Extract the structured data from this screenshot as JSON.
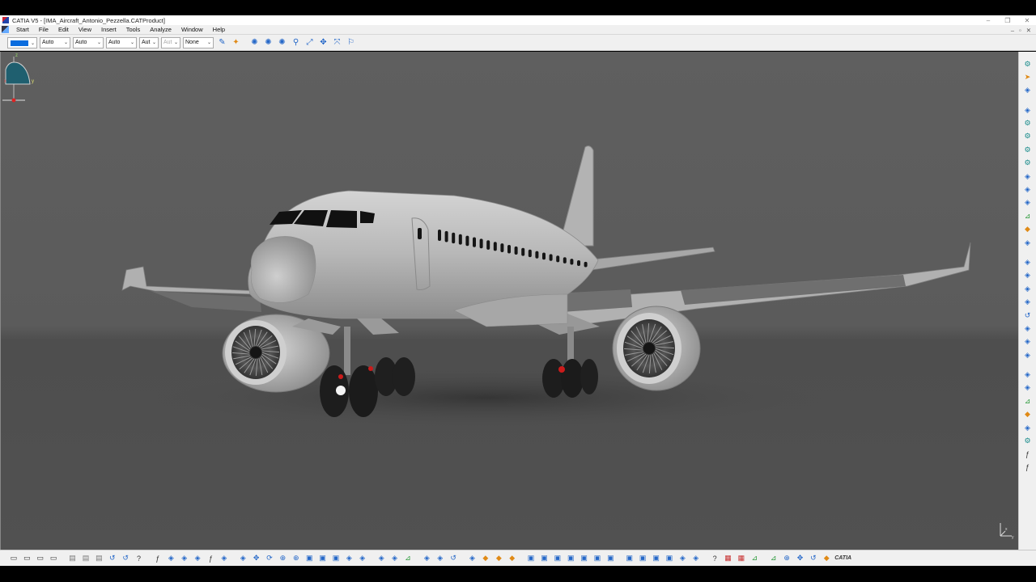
{
  "window": {
    "title": "CATIA V5 - [IMA_Aircraft_Antonio_Pezzella.CATProduct]",
    "controls": [
      "–",
      "❐",
      "✕"
    ]
  },
  "menu": {
    "items": [
      "Start",
      "File",
      "Edit",
      "View",
      "Insert",
      "Tools",
      "Analyze",
      "Window",
      "Help"
    ],
    "doc_controls": [
      "–",
      "▫",
      "✕"
    ]
  },
  "graphic_properties": {
    "color": "#0a6cde",
    "transparency": "Auto",
    "line_thickness": "Auto",
    "line_type": "Auto",
    "point_type": "Aut",
    "point_size": "Aut",
    "layer": "None"
  },
  "colors": {
    "toolbar_bg": "#f0f0f0",
    "viewport_bg": "#5e5e5e",
    "aircraft_body": "#b9b9b9",
    "compass_fill": "#1f5f6f"
  },
  "top_toolbar_icons": [
    "format-painter-icon",
    "apply-material-icon",
    "rotate-icon",
    "rotate-icon",
    "rotate-icon",
    "snap-icon",
    "explode-icon",
    "manipulate-icon",
    "move-icon",
    "flag-icon"
  ],
  "right_toolbar_icons": [
    "catalog-icon",
    "select-icon",
    "sketch-icon",
    "line-icon",
    "product-icon",
    "component-icon",
    "part-icon",
    "existing-component-icon",
    "replace-icon",
    "graph-tree-icon",
    "numbering-icon",
    "constraint-icon",
    "bill-of-material-icon",
    "publication-icon",
    "fix-icon",
    "contact-icon",
    "offset-icon",
    "angle-icon",
    "update-icon",
    "reuse-pattern-icon",
    "coincidence-icon",
    "snapshot-icon",
    "section-icon",
    "clash-icon",
    "measure-icon",
    "scene-icon",
    "annotation-icon",
    "catalog-browser-icon",
    "parameters-icon",
    "formula-icon"
  ],
  "bottom_toolbar_icons": [
    "new-icon",
    "open-icon",
    "save-icon",
    "print-icon",
    "cut-icon",
    "copy-icon",
    "paste-icon",
    "undo-icon",
    "redo-icon",
    "whats-this-icon",
    "formula-icon",
    "comment-icon",
    "fly-mode-icon",
    "table-icon",
    "knowledge-icon",
    "sketch-icon",
    "fit-all-icon",
    "pan-icon",
    "rotate-view-icon",
    "zoom-in-icon",
    "zoom-out-icon",
    "normal-view-icon",
    "iso-view-icon",
    "multi-view-icon",
    "hide-show-icon",
    "swap-icon",
    "camera-icon",
    "properties-icon",
    "measure-between-icon",
    "analysis-icon",
    "cloud-icon",
    "loop-icon",
    "sketch-plane-icon",
    "material-icon",
    "render-icon",
    "shading-icon",
    "front-view-icon",
    "back-view-icon",
    "left-view-icon",
    "right-view-icon",
    "top-view-icon",
    "bottom-view-icon",
    "iso-icon",
    "cylinder-icon",
    "cube-icon",
    "cone-icon",
    "sphere-icon",
    "axis-icon",
    "capture-icon",
    "help-icon",
    "grid-icon",
    "snap-grid-icon",
    "constraint-icon",
    "dimension-icon",
    "zoom-area-icon",
    "manipulate-icon",
    "update-icon",
    "scene-icon",
    "catia-logo-icon"
  ],
  "compass_axes": {
    "x": "x",
    "y": "y",
    "z": "z"
  },
  "mini_axes": {
    "x": "x",
    "y": "y"
  },
  "catia_logo": "CATIA"
}
